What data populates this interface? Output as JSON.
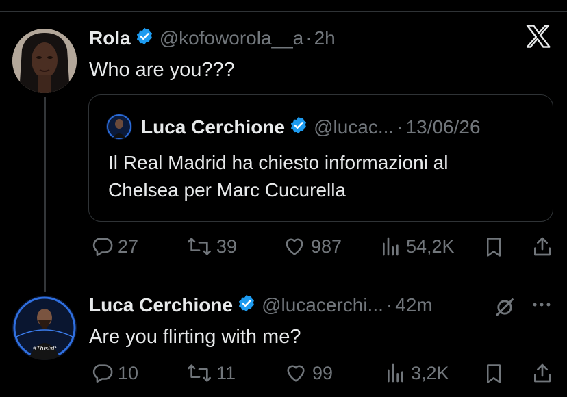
{
  "tweet": {
    "author_name": "Rola",
    "handle": "@kofoworola__a",
    "separator": "·",
    "time": "2h",
    "text": "Who are you???",
    "quote": {
      "author_name": "Luca Cerchione",
      "handle": "@lucac...",
      "separator": "·",
      "date": "13/06/26",
      "text_line1": "Il Real Madrid ha chiesto informazioni al",
      "text_line2": "Chelsea per Marc Cucurella"
    },
    "actions": {
      "replies": "27",
      "reposts": "39",
      "likes": "987",
      "views": "54,2K"
    }
  },
  "reply": {
    "author_name": "Luca Cerchione",
    "handle": "@lucacerchi...",
    "separator": "·",
    "time": "42m",
    "text": "Are you flirting with me?",
    "actions": {
      "replies": "10",
      "reposts": "11",
      "likes": "99",
      "views": "3,2K"
    }
  },
  "colors": {
    "background": "#000000",
    "text": "#e7e9ea",
    "muted": "#71767b",
    "verified": "#1d9bf0",
    "border": "#2f3336"
  },
  "icons": [
    "verified-badge-icon",
    "x-logo-icon",
    "reply-icon",
    "repost-icon",
    "like-icon",
    "views-icon",
    "bookmark-icon",
    "share-icon",
    "grok-icon",
    "more-icon"
  ]
}
